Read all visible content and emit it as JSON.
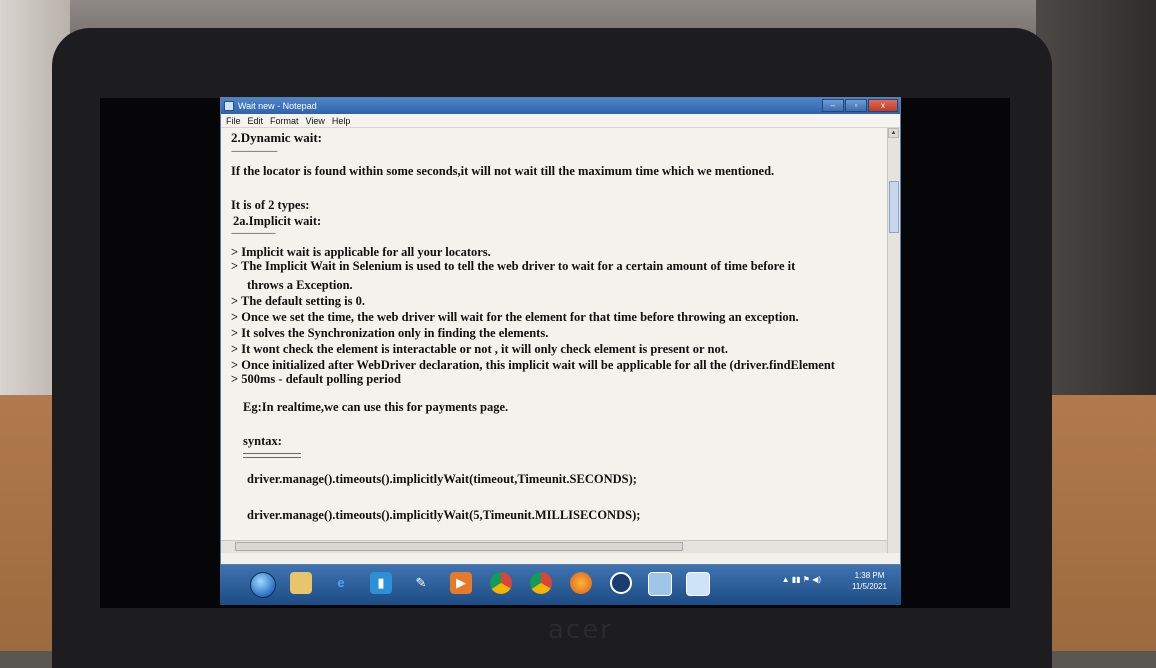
{
  "window": {
    "title": "Wait new - Notepad",
    "controls": [
      "–",
      "▫",
      "x"
    ]
  },
  "menu": [
    "File",
    "Edit",
    "Format",
    "View",
    "Help"
  ],
  "document": {
    "heading": "2.Dynamic wait:",
    "intro": "If the locator is found within some seconds,it will not wait till the maximum time which we mentioned.",
    "types_line": "It is of 2 types:",
    "subheading": "2a.Implicit wait:",
    "bullets": [
      "> Implicit wait is applicable for all your locators.",
      "> The Implicit Wait in Selenium is used to tell the web driver to wait for a certain amount of time before it",
      "throws a Exception.",
      "> The default setting is 0.",
      "> Once we set the time, the web driver will wait for the element for that time before throwing an exception.",
      "> It solves the Synchronization only in finding the elements.",
      "> It wont check the element is interactable or not , it will only check element is present or not.",
      "> Once initialized after WebDriver declaration, this implicit wait will be applicable for all the (driver.findElement",
      "> 500ms - default polling period"
    ],
    "example": "Eg:In realtime,we can use this for payments page.",
    "syntax_label": "syntax:",
    "code": [
      "driver.manage().timeouts().implicitlyWait(timeout,Timeunit.SECONDS);",
      "driver.manage().timeouts().implicitlyWait(5,Timeunit.MILLISECONDS);"
    ]
  },
  "taskbar": {
    "icons": [
      "windows-explorer-icon",
      "internet-explorer-icon",
      "video-icon",
      "tools-icon",
      "media-player-icon",
      "chrome-icon",
      "chrome-icon",
      "firefox-icon",
      "app-icon",
      "photo-viewer-icon",
      "notepad-icon"
    ],
    "clock_time": "1:38 PM",
    "clock_date": "11/5/2021"
  },
  "laptop": {
    "brand": "acer"
  }
}
